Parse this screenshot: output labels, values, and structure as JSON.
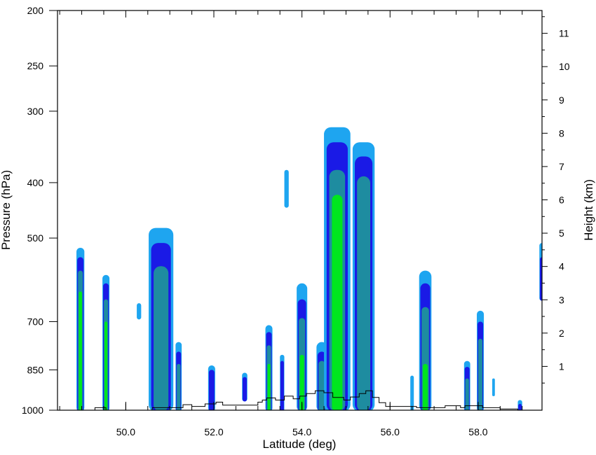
{
  "chart_data": {
    "type": "heatmap",
    "xlabel": "Latitude (deg)",
    "ylabel_left": "Pressure (hPa)",
    "ylabel_right": "Height (km)",
    "xlim": [
      48.45,
      59.45
    ],
    "ylim_left": [
      1000,
      200
    ],
    "ylim_right": [
      0,
      12
    ],
    "left_axis_scale": "log",
    "grid": false,
    "x_ticks": [
      {
        "value": 50,
        "label": "50.0"
      },
      {
        "value": 52,
        "label": "52.0"
      },
      {
        "value": 54,
        "label": "54.0"
      },
      {
        "value": 56,
        "label": "56.0"
      },
      {
        "value": 58,
        "label": "58.0"
      }
    ],
    "y_left_ticks": [
      {
        "value": 200,
        "label": "200"
      },
      {
        "value": 250,
        "label": "250"
      },
      {
        "value": 300,
        "label": "300"
      },
      {
        "value": 400,
        "label": "400"
      },
      {
        "value": 500,
        "label": "500"
      },
      {
        "value": 700,
        "label": "700"
      },
      {
        "value": 850,
        "label": "850"
      },
      {
        "value": 1000,
        "label": "1000"
      }
    ],
    "y_right_ticks": [
      {
        "value": 1,
        "label": "1"
      },
      {
        "value": 2,
        "label": "2"
      },
      {
        "value": 3,
        "label": "3"
      },
      {
        "value": 4,
        "label": "4"
      },
      {
        "value": 5,
        "label": "5"
      },
      {
        "value": 6,
        "label": "6"
      },
      {
        "value": 7,
        "label": "7"
      },
      {
        "value": 8,
        "label": "8"
      },
      {
        "value": 9,
        "label": "9"
      },
      {
        "value": 10,
        "label": "10"
      },
      {
        "value": 11,
        "label": "11"
      }
    ],
    "contour_colors": [
      "#1ea5f0",
      "#1a1ae6",
      "#1e8ca0",
      "#00e61e",
      "#dcc81e",
      "#f06414"
    ],
    "cells": [
      {
        "lat": 48.97,
        "halfwidth": 0.09,
        "top": 520,
        "bottom": 1000,
        "levels": [
          520,
          540,
          570,
          620
        ]
      },
      {
        "lat": 49.55,
        "halfwidth": 0.08,
        "top": 580,
        "bottom": 1000,
        "levels": [
          580,
          600,
          640,
          700
        ]
      },
      {
        "lat": 50.3,
        "halfwidth": 0.05,
        "top": 650,
        "bottom": 690,
        "levels": [
          650
        ]
      },
      {
        "lat": 50.8,
        "halfwidth": 0.28,
        "top": 480,
        "bottom": 1000,
        "levels": [
          480,
          510,
          560
        ]
      },
      {
        "lat": 51.2,
        "halfwidth": 0.07,
        "top": 760,
        "bottom": 1000,
        "levels": [
          760,
          790,
          830
        ]
      },
      {
        "lat": 51.95,
        "halfwidth": 0.08,
        "top": 835,
        "bottom": 1000,
        "levels": [
          835,
          850
        ]
      },
      {
        "lat": 52.7,
        "halfwidth": 0.06,
        "top": 860,
        "bottom": 960,
        "levels": [
          860,
          875
        ]
      },
      {
        "lat": 53.25,
        "halfwidth": 0.08,
        "top": 710,
        "bottom": 1000,
        "levels": [
          710,
          730,
          770,
          830
        ]
      },
      {
        "lat": 53.65,
        "halfwidth": 0.05,
        "top": 380,
        "bottom": 440,
        "levels": [
          380
        ]
      },
      {
        "lat": 53.55,
        "halfwidth": 0.05,
        "top": 800,
        "bottom": 1000,
        "levels": [
          800,
          820
        ]
      },
      {
        "lat": 54.0,
        "halfwidth": 0.12,
        "top": 600,
        "bottom": 1000,
        "levels": [
          600,
          640,
          690,
          800
        ]
      },
      {
        "lat": 54.45,
        "halfwidth": 0.12,
        "top": 760,
        "bottom": 1000,
        "levels": [
          760,
          790,
          820
        ]
      },
      {
        "lat": 54.8,
        "halfwidth": 0.3,
        "top": 320,
        "bottom": 1000,
        "levels": [
          320,
          340,
          380,
          420
        ]
      },
      {
        "lat": 55.4,
        "halfwidth": 0.25,
        "top": 340,
        "bottom": 1000,
        "levels": [
          340,
          360,
          390
        ]
      },
      {
        "lat": 56.5,
        "halfwidth": 0.04,
        "top": 870,
        "bottom": 1000,
        "levels": [
          870
        ]
      },
      {
        "lat": 56.8,
        "halfwidth": 0.14,
        "top": 570,
        "bottom": 1000,
        "levels": [
          570,
          600,
          660,
          830
        ]
      },
      {
        "lat": 57.75,
        "halfwidth": 0.07,
        "top": 820,
        "bottom": 1000,
        "levels": [
          820,
          840,
          880
        ]
      },
      {
        "lat": 58.05,
        "halfwidth": 0.08,
        "top": 670,
        "bottom": 1000,
        "levels": [
          670,
          700,
          750
        ]
      },
      {
        "lat": 58.35,
        "halfwidth": 0.03,
        "top": 880,
        "bottom": 940,
        "levels": [
          880
        ]
      },
      {
        "lat": 58.95,
        "halfwidth": 0.05,
        "top": 960,
        "bottom": 1000,
        "levels": [
          960,
          975
        ]
      },
      {
        "lat": 59.45,
        "halfwidth": 0.06,
        "top": 510,
        "bottom": 640,
        "levels": [
          510,
          540
        ]
      }
    ],
    "terrain": [
      [
        48.45,
        1000
      ],
      [
        49.3,
        1000
      ],
      [
        49.3,
        990
      ],
      [
        49.55,
        990
      ],
      [
        49.55,
        1000
      ],
      [
        50.6,
        1000
      ],
      [
        50.6,
        990
      ],
      [
        51.3,
        990
      ],
      [
        51.3,
        978
      ],
      [
        51.5,
        978
      ],
      [
        51.5,
        985
      ],
      [
        51.8,
        985
      ],
      [
        51.8,
        975
      ],
      [
        52.05,
        975
      ],
      [
        52.05,
        968
      ],
      [
        52.2,
        968
      ],
      [
        52.2,
        980
      ],
      [
        53.0,
        980
      ],
      [
        53.0,
        968
      ],
      [
        53.1,
        968
      ],
      [
        53.1,
        960
      ],
      [
        53.2,
        960
      ],
      [
        53.2,
        952
      ],
      [
        53.4,
        952
      ],
      [
        53.4,
        960
      ],
      [
        53.6,
        960
      ],
      [
        53.6,
        945
      ],
      [
        53.8,
        945
      ],
      [
        53.8,
        955
      ],
      [
        53.95,
        955
      ],
      [
        53.95,
        945
      ],
      [
        54.1,
        945
      ],
      [
        54.1,
        935
      ],
      [
        54.3,
        935
      ],
      [
        54.3,
        925
      ],
      [
        54.5,
        925
      ],
      [
        54.5,
        932
      ],
      [
        54.7,
        932
      ],
      [
        54.7,
        950
      ],
      [
        54.95,
        950
      ],
      [
        54.95,
        960
      ],
      [
        55.1,
        960
      ],
      [
        55.1,
        948
      ],
      [
        55.3,
        948
      ],
      [
        55.3,
        935
      ],
      [
        55.45,
        935
      ],
      [
        55.45,
        925
      ],
      [
        55.6,
        925
      ],
      [
        55.6,
        950
      ],
      [
        55.75,
        950
      ],
      [
        55.75,
        970
      ],
      [
        55.9,
        970
      ],
      [
        55.9,
        985
      ],
      [
        56.6,
        985
      ],
      [
        56.6,
        990
      ],
      [
        57.25,
        990
      ],
      [
        57.25,
        982
      ],
      [
        57.6,
        982
      ],
      [
        57.6,
        990
      ],
      [
        57.7,
        990
      ],
      [
        57.7,
        982
      ],
      [
        58.1,
        982
      ],
      [
        58.1,
        990
      ],
      [
        58.5,
        990
      ],
      [
        58.5,
        995
      ],
      [
        58.9,
        995
      ],
      [
        58.9,
        1000
      ],
      [
        59.45,
        1000
      ]
    ]
  }
}
